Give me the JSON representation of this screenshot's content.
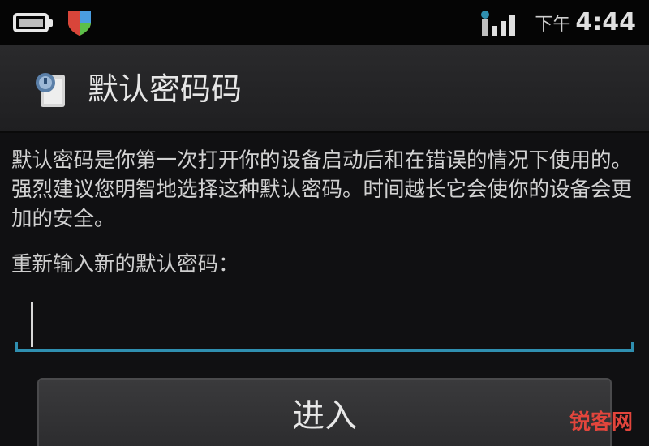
{
  "status_bar": {
    "battery_icon": "battery-icon",
    "app_icon": "shield-app-icon",
    "signal_icon": "signal-bars-icon",
    "ampm": "下午",
    "time": "4:44"
  },
  "dialog": {
    "title_icon": "lock-document-icon",
    "title": "默认密码码",
    "description": "默认密码是你第一次打开你的设备启动后和在错误的情况下使用的。强烈建议您明智地选择这种默认密码。时间越长它会使你的设备会更加的安全。",
    "prompt": "重新输入新的默认密码：",
    "password_value": "",
    "enter_button": "进入"
  },
  "watermark": "锐客网",
  "colors": {
    "accent": "#2f8fb0",
    "watermark": "#e2453c",
    "background": "#101012"
  }
}
